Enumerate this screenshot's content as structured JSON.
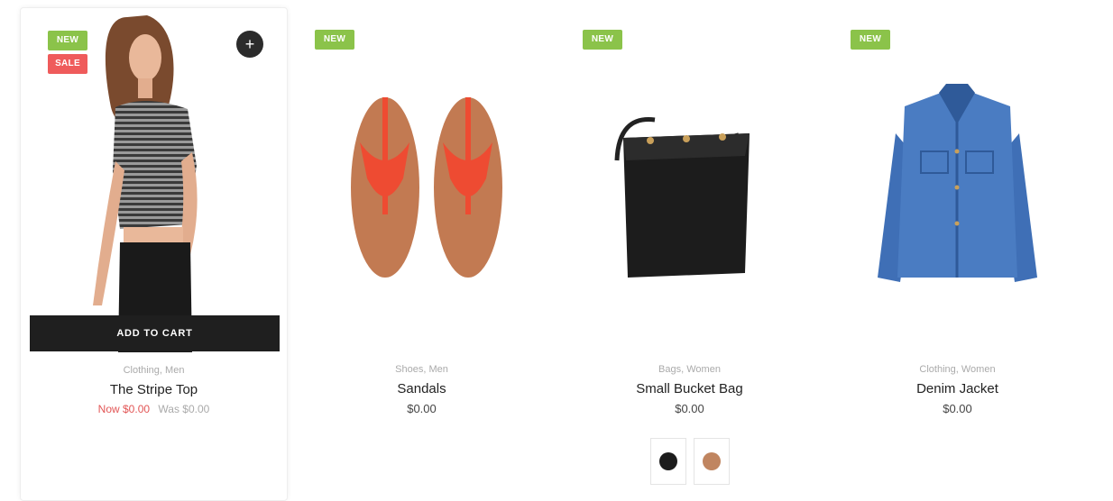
{
  "colors": {
    "new_badge": "#8bc34a",
    "sale_badge": "#ef5b5b",
    "button_bg": "#1f1f1f",
    "sale_price": "#e25555"
  },
  "products": [
    {
      "badge_new": "NEW",
      "badge_sale": "SALE",
      "wishlist_icon": "plus-icon",
      "add_to_cart": "ADD TO CART",
      "category": "Clothing, Men",
      "title": "The Stripe Top",
      "price_now": "Now $0.00",
      "price_old": "Was $0.00"
    },
    {
      "badge_new": "NEW",
      "category": "Shoes, Men",
      "title": "Sandals",
      "price": "$0.00"
    },
    {
      "badge_new": "NEW",
      "category": "Bags, Women",
      "title": "Small Bucket Bag",
      "price": "$0.00",
      "swatches": [
        "#1c1c1c",
        "#c08560"
      ]
    },
    {
      "badge_new": "NEW",
      "category": "Clothing, Women",
      "title": "Denim Jacket",
      "price": "$0.00"
    }
  ]
}
